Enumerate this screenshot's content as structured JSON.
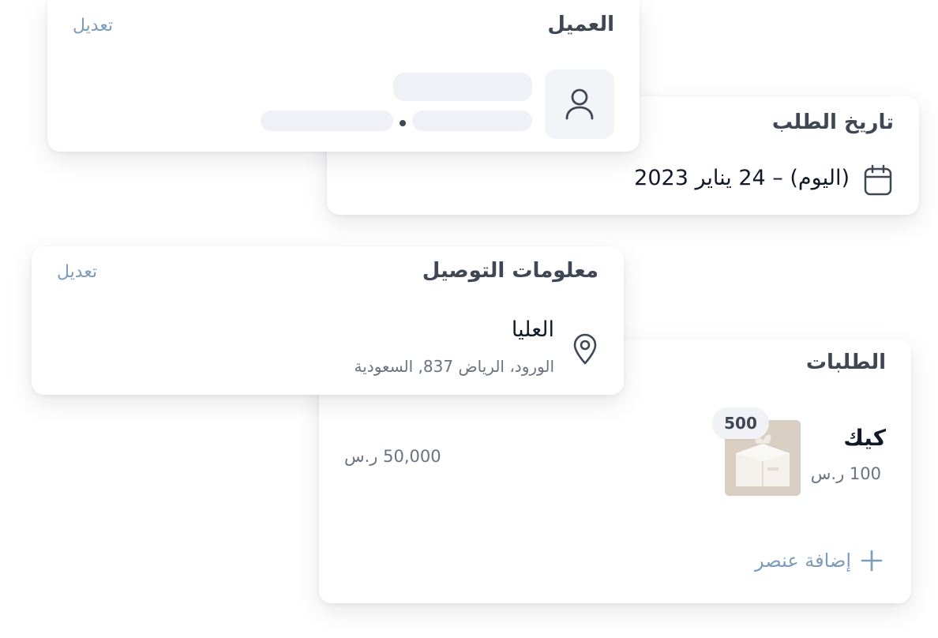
{
  "customer_card": {
    "title": "العميل",
    "edit_label": "تعديل"
  },
  "order_date_card": {
    "title": "تاريخ الطلب",
    "date_text": "(اليوم) – 24 يناير 2023"
  },
  "delivery_card": {
    "title": "معلومات التوصيل",
    "edit_label": "تعديل",
    "place_name": "العليا",
    "address": "الورود، الرياض 837, السعودية"
  },
  "orders_card": {
    "title": "الطلبات",
    "items": [
      {
        "name": "كيك",
        "price": "100 ر.س",
        "quantity": "500"
      }
    ],
    "total": "50,000 ر.س",
    "add_item_label": "إضافة عنصر"
  },
  "icons": {
    "avatar": "user-icon",
    "calendar": "calendar-icon",
    "location": "map-pin-icon",
    "add": "plus-icon"
  },
  "colors": {
    "title": "#3f4755",
    "link": "#7c9cbc",
    "muted": "#6b7280",
    "skeleton": "#eff1f6"
  }
}
